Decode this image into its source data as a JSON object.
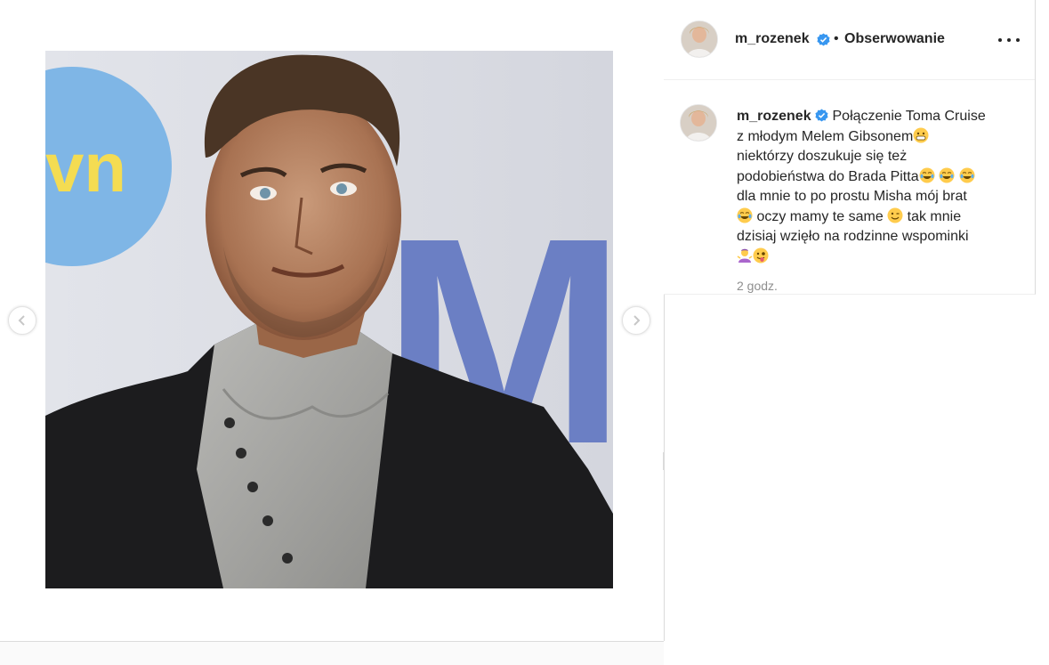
{
  "post": {
    "username": "m_rozenek",
    "follow_separator": "•",
    "follow_label": "Obserwowanie",
    "more_icon": "more-horizontal-icon",
    "verified_icon": "verified-badge-icon",
    "caption_lines": [
      "Połączenie Toma Cruise",
      "z młodym Melem Gibsonem",
      "niektórzy doszukuje się też",
      "podobieństwa do Brada Pitta",
      "dla mnie to po prostu Misha mój brat",
      "oczy mamy te same",
      "tak mnie",
      "dzisiaj wzięło na rodzinne wspominki"
    ],
    "timestamp": "2 godz."
  },
  "photo": {
    "backdrop_logo_text": "vn",
    "backdrop_letter": "M"
  },
  "nav": {
    "prev_icon": "chevron-left-icon",
    "next_icon": "chevron-right-icon"
  },
  "colors": {
    "text": "#262626",
    "muted": "#8e8e8e",
    "verified": "#3897f0",
    "border": "#dbdbdb",
    "backdrop_blue": "#6b7fc4",
    "logo_blue": "#7fb6e6",
    "logo_yellow": "#f4dc52"
  }
}
